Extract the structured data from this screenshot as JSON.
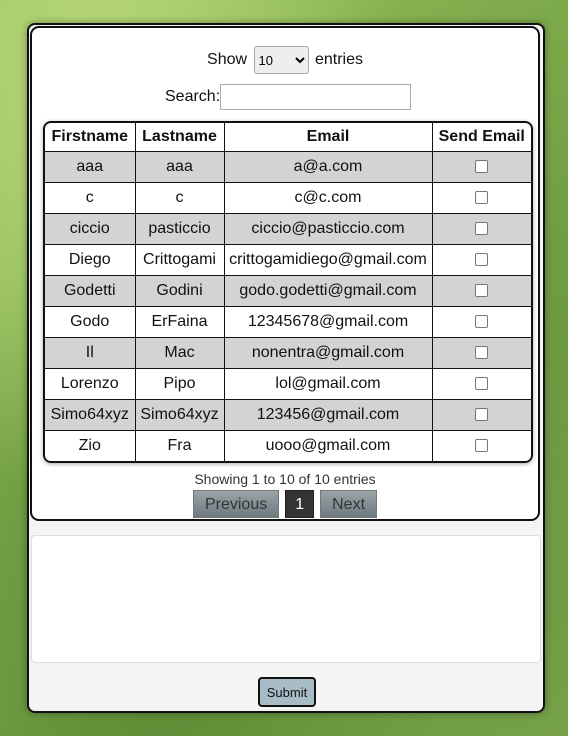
{
  "length_menu": {
    "prefix": "Show",
    "selected": "10",
    "suffix": "entries"
  },
  "search": {
    "label": "Search:",
    "value": ""
  },
  "table": {
    "headers": [
      "Firstname",
      "Lastname",
      "Email",
      "Send Email"
    ],
    "rows": [
      {
        "first": "aaa",
        "last": "aaa",
        "email": "a@a.com",
        "send": false
      },
      {
        "first": "c",
        "last": "c",
        "email": "c@c.com",
        "send": false
      },
      {
        "first": "ciccio",
        "last": "pasticcio",
        "email": "ciccio@pasticcio.com",
        "send": false
      },
      {
        "first": "Diego",
        "last": "Crittogami",
        "email": "crittogamidiego@gmail.com",
        "send": false
      },
      {
        "first": "Godetti",
        "last": "Godini",
        "email": "godo.godetti@gmail.com",
        "send": false
      },
      {
        "first": "Godo",
        "last": "ErFaina",
        "email": "12345678@gmail.com",
        "send": false
      },
      {
        "first": "Il",
        "last": "Mac",
        "email": "nonentra@gmail.com",
        "send": false
      },
      {
        "first": "Lorenzo",
        "last": "Pipo",
        "email": "lol@gmail.com",
        "send": false
      },
      {
        "first": "Simo64xyz",
        "last": "Simo64xyz",
        "email": "123456@gmail.com",
        "send": false
      },
      {
        "first": "Zio",
        "last": "Fra",
        "email": "uooo@gmail.com",
        "send": false
      }
    ]
  },
  "info_text": "Showing 1 to 10 of 10 entries",
  "pagination": {
    "previous": "Previous",
    "current": "1",
    "next": "Next"
  },
  "submit_label": "Submit",
  "colors": {
    "row_stripe": "#d3d3d3",
    "submit_bg": "#a8bcc8",
    "current_page_bg": "#333333"
  }
}
